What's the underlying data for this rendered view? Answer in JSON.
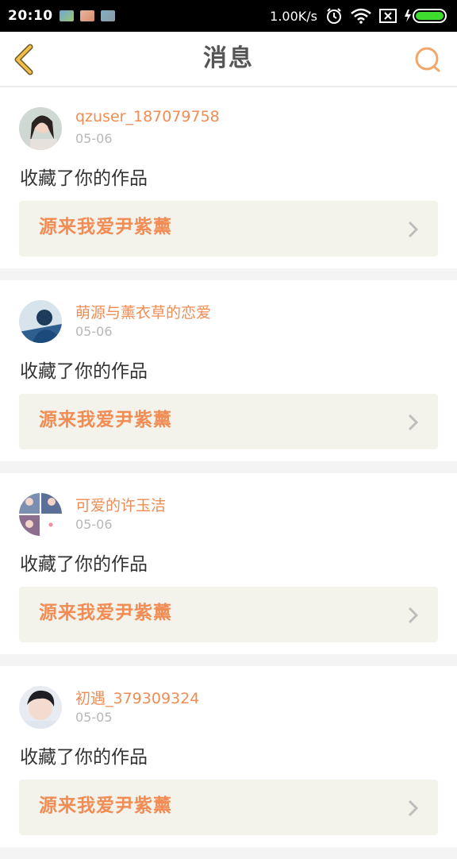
{
  "status_bar": {
    "time": "20:10",
    "net_speed": "1.00K/s"
  },
  "header": {
    "title": "消息",
    "accent_color": "#f2a76a"
  },
  "messages": [
    {
      "username": "qzuser_187079758",
      "date": "05-06",
      "action": "收藏了你的作品",
      "work": "源来我爱尹紫薰"
    },
    {
      "username": "萌源与薰衣草的恋爱",
      "date": "05-06",
      "action": "收藏了你的作品",
      "work": "源来我爱尹紫薰"
    },
    {
      "username": "可爱的许玉洁",
      "date": "05-06",
      "action": "收藏了你的作品",
      "work": "源来我爱尹紫薰"
    },
    {
      "username": "初遇_379309324",
      "date": "05-05",
      "action": "收藏了你的作品",
      "work": "源来我爱尹紫薰"
    }
  ]
}
